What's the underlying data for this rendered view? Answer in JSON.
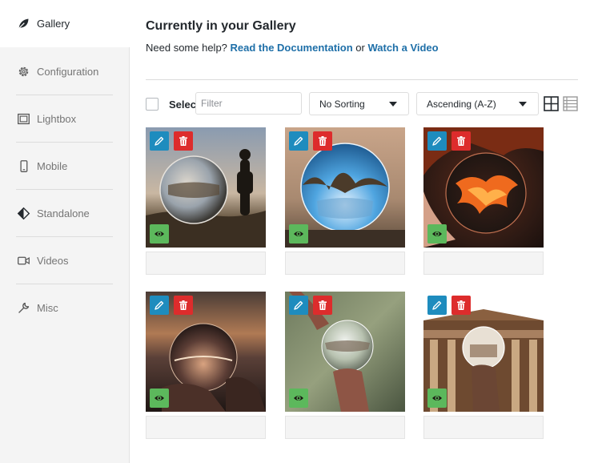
{
  "sidebar": {
    "items": [
      {
        "label": "Gallery",
        "icon": "leaf-icon",
        "active": true
      },
      {
        "label": "Configuration",
        "icon": "gear-icon"
      },
      {
        "label": "Lightbox",
        "icon": "lightbox-icon"
      },
      {
        "label": "Mobile",
        "icon": "mobile-icon"
      },
      {
        "label": "Standalone",
        "icon": "standalone-icon"
      },
      {
        "label": "Videos",
        "icon": "video-icon"
      },
      {
        "label": "Misc",
        "icon": "wrench-icon"
      }
    ]
  },
  "header": {
    "title": "Currently in your Gallery",
    "help_prefix": "Need some help?",
    "doc_link": "Read the Documentation",
    "or_text": "or",
    "video_link": "Watch a Video"
  },
  "toolbar": {
    "select_label": "Select",
    "filter_placeholder": "Filter",
    "sorting_value": "No Sorting",
    "order_value": "Ascending (A-Z)",
    "grid_icon": "grid-view-icon",
    "list_icon": "list-view-icon"
  },
  "gallery": {
    "images": [
      {
        "caption": ""
      },
      {
        "caption": ""
      },
      {
        "caption": ""
      },
      {
        "caption": ""
      },
      {
        "caption": ""
      },
      {
        "caption": ""
      }
    ]
  },
  "colors": {
    "link": "#1e6fa8",
    "edit": "#1e8cbe",
    "delete": "#dd2c2c",
    "view": "#5cb85c"
  }
}
